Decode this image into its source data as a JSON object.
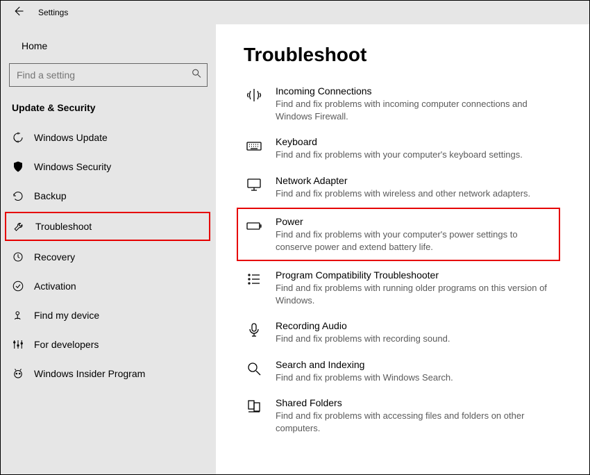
{
  "titlebar": {
    "title": "Settings"
  },
  "sidebar": {
    "home_label": "Home",
    "search_placeholder": "Find a setting",
    "category_label": "Update & Security",
    "items": [
      {
        "label": "Windows Update"
      },
      {
        "label": "Windows Security"
      },
      {
        "label": "Backup"
      },
      {
        "label": "Troubleshoot"
      },
      {
        "label": "Recovery"
      },
      {
        "label": "Activation"
      },
      {
        "label": "Find my device"
      },
      {
        "label": "For developers"
      },
      {
        "label": "Windows Insider Program"
      }
    ]
  },
  "main": {
    "title": "Troubleshoot",
    "items": [
      {
        "title": "Incoming Connections",
        "desc": "Find and fix problems with incoming computer connections and Windows Firewall."
      },
      {
        "title": "Keyboard",
        "desc": "Find and fix problems with your computer's keyboard settings."
      },
      {
        "title": "Network Adapter",
        "desc": "Find and fix problems with wireless and other network adapters."
      },
      {
        "title": "Power",
        "desc": "Find and fix problems with your computer's power settings to conserve power and extend battery life."
      },
      {
        "title": "Program Compatibility Troubleshooter",
        "desc": "Find and fix problems with running older programs on this version of Windows."
      },
      {
        "title": "Recording Audio",
        "desc": "Find and fix problems with recording sound."
      },
      {
        "title": "Search and Indexing",
        "desc": "Find and fix problems with Windows Search."
      },
      {
        "title": "Shared Folders",
        "desc": "Find and fix problems with accessing files and folders on other computers."
      }
    ]
  }
}
